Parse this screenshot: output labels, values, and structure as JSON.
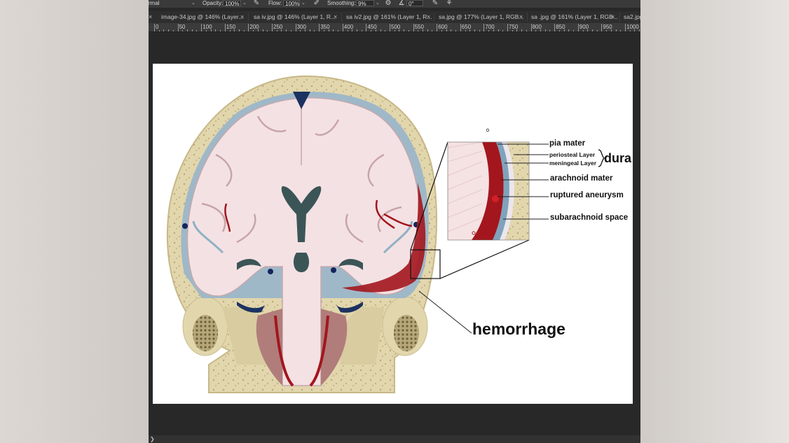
{
  "options_bar": {
    "mode_value": "rmal",
    "opacity_label": "Opacity:",
    "opacity_value": "100%",
    "flow_label": "Flow:",
    "flow_value": "100%",
    "smoothing_label": "Smoothing:",
    "smoothing_value": "9%",
    "angle_value": "0°"
  },
  "tabs": [
    {
      "label": "image-34.jpg @ 146% (Layer..."
    },
    {
      "label": "sa iv.jpg @ 146% (Layer 1, R..."
    },
    {
      "label": "sa iv2.jpg @ 161% (Layer 1, R..."
    },
    {
      "label": "sa.jpg @ 177% (Layer 1, RGB..."
    },
    {
      "label": "sa .jpg @ 161% (Layer 1, RGB..."
    },
    {
      "label": "sa2.jpg"
    }
  ],
  "ruler": {
    "labels": [
      "0",
      "50",
      "100",
      "150",
      "200",
      "250",
      "300",
      "350",
      "400",
      "450",
      "500",
      "550",
      "600",
      "650",
      "700",
      "750",
      "800",
      "850",
      "900",
      "950",
      "1000"
    ]
  },
  "diagram": {
    "labels": {
      "pia_mater": "pia mater",
      "periosteal": "periosteal Layer",
      "meningeal": "meningeal Layer",
      "dura": "dura",
      "arachnoid": "arachnoid mater",
      "aneurysm": "ruptured aneurysm",
      "subarachnoid": "subarachnoid space",
      "hemorrhage": "hemorrhage"
    }
  },
  "colors": {
    "skull": "#e2d6ad",
    "skull_dark": "#cbbd8c",
    "brain": "#f4e1e3",
    "brain_dark": "#d9b7bd",
    "ventricle": "#3b5557",
    "vessel_blue": "#13265d",
    "blood": "#a3161d",
    "meninge_blue": "#7fa3bc"
  },
  "status": {
    "text": "❯"
  }
}
